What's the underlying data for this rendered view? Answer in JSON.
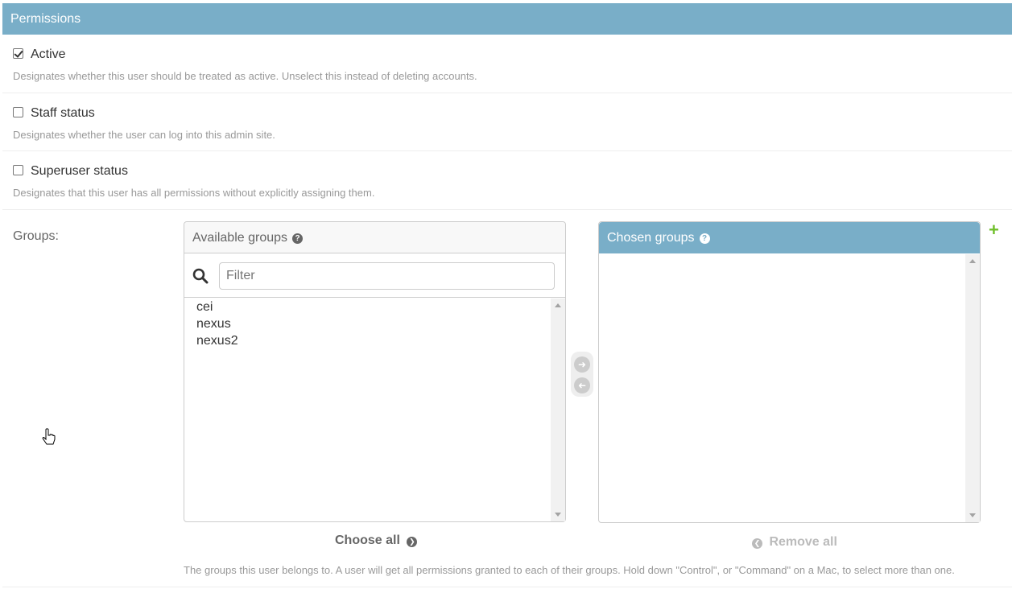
{
  "module": {
    "title": "Permissions"
  },
  "fields": {
    "active": {
      "label": "Active",
      "checked": true,
      "help": "Designates whether this user should be treated as active. Unselect this instead of deleting accounts."
    },
    "staff": {
      "label": "Staff status",
      "checked": false,
      "help": "Designates whether the user can log into this admin site."
    },
    "superuser": {
      "label": "Superuser status",
      "checked": false,
      "help": "Designates that this user has all permissions without explicitly assigning them."
    }
  },
  "groups": {
    "label": "Groups:",
    "available": {
      "title": "Available groups",
      "help_icon": "?",
      "filter_placeholder": "Filter",
      "filter_value": "",
      "options": [
        "cei",
        "nexus",
        "nexus2"
      ]
    },
    "chosen": {
      "title": "Chosen groups",
      "help_icon": "?",
      "options": []
    },
    "choose_all_label": "Choose all",
    "remove_all_label": "Remove all",
    "add_icon": "+",
    "help": "The groups this user belongs to. A user will get all permissions granted to each of their groups. Hold down \"Control\", or \"Command\" on a Mac, to select more than one."
  },
  "colors": {
    "header_bg": "#79aec8",
    "add_green": "#70bf2b"
  },
  "icons": {
    "search": "search-icon",
    "help": "help-icon",
    "move_right": "arrow-right-circle-icon",
    "move_left": "arrow-left-circle-icon",
    "add": "add-icon"
  }
}
